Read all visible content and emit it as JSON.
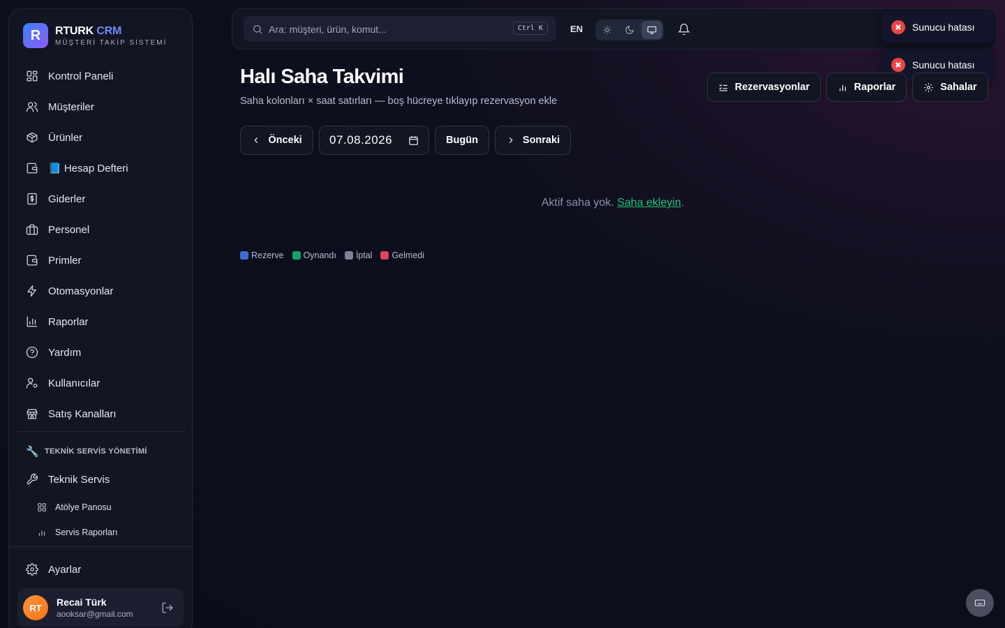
{
  "brand": {
    "name": "RTURK",
    "name_accent": "CRM",
    "subtitle": "MÜŞTERİ TAKİP SİSTEMİ",
    "logo_letter": "R"
  },
  "sidebar": {
    "items": [
      {
        "label": "Kontrol Paneli",
        "icon": "dashboard-icon"
      },
      {
        "label": "Müşteriler",
        "icon": "users-icon"
      },
      {
        "label": "Ürünler",
        "icon": "box-icon"
      },
      {
        "label": "📘 Hesap Defteri",
        "icon": "wallet-icon"
      },
      {
        "label": "Giderler",
        "icon": "receipt-icon"
      },
      {
        "label": "Personel",
        "icon": "briefcase-icon"
      },
      {
        "label": "Primler",
        "icon": "wallet-icon"
      },
      {
        "label": "Otomasyonlar",
        "icon": "lightning-icon"
      },
      {
        "label": "Raporlar",
        "icon": "bar-chart-icon"
      },
      {
        "label": "Yardım",
        "icon": "help-icon"
      },
      {
        "label": "Kullanıcılar",
        "icon": "user-cog-icon"
      },
      {
        "label": "Satış Kanalları",
        "icon": "store-icon"
      }
    ],
    "section_title": "TEKNİK SERVİS YÖNETİMİ",
    "section_icon": "🔧",
    "tech_service": {
      "label": "Teknik Servis",
      "icon": "wrench-icon"
    },
    "sub_items": [
      {
        "label": "Atölye Panosu",
        "icon": "grid-icon"
      },
      {
        "label": "Servis Raporları",
        "icon": "bar-chart-icon"
      }
    ],
    "settings": {
      "label": "Ayarlar",
      "icon": "gear-icon"
    }
  },
  "user": {
    "initials": "RT",
    "name": "Recai Türk",
    "email": "aooksar@gmail.com"
  },
  "topbar": {
    "search_placeholder": "Ara: müşteri, ürün, komut...",
    "search_shortcut": "Ctrl K",
    "language": "EN",
    "theme_active": "system"
  },
  "toasts": [
    {
      "message": "Sunucu hatası"
    },
    {
      "message": "Sunucu hatası"
    }
  ],
  "page": {
    "title": "Halı Saha Takvimi",
    "subtitle": "Saha kolonları × saat satırları — boş hücreye tıklayıp rezervasyon ekle",
    "actions": {
      "reservations": "Rezervasyonlar",
      "reports": "Raporlar",
      "fields": "Sahalar"
    },
    "date_nav": {
      "prev": "Önceki",
      "date": "07.08.2026",
      "today": "Bugün",
      "next": "Sonraki"
    },
    "empty_text": "Aktif saha yok.",
    "empty_link": "Saha ekleyin",
    "empty_suffix": ".",
    "legend": [
      {
        "label": "Rezerve",
        "color": "#3b6fd4"
      },
      {
        "label": "Oynandı",
        "color": "#16a36a"
      },
      {
        "label": "İptal",
        "color": "#7c8194"
      },
      {
        "label": "Gelmedi",
        "color": "#e0445c"
      }
    ]
  }
}
